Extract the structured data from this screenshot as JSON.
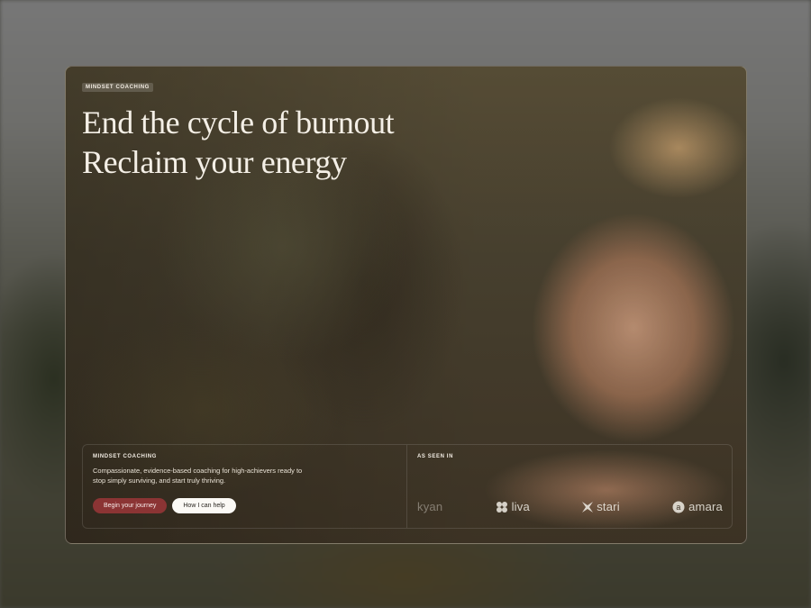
{
  "hero": {
    "eyebrow": "MINDSET COACHING",
    "headline_line1": "End the cycle of burnout",
    "headline_line2": "Reclaim your energy"
  },
  "panel": {
    "left_label": "MINDSET COACHING",
    "description": "Compassionate, evidence-based coaching for high-achievers ready to stop simply surviving, and start truly thriving.",
    "primary_button": "Begin your journey",
    "secondary_button": "How I can help",
    "right_label": "AS SEEN IN",
    "logos": [
      {
        "name": "kyan",
        "icon": "kyan-logo-icon"
      },
      {
        "name": "liva",
        "icon": "liva-logo-icon"
      },
      {
        "name": "stari",
        "icon": "stari-logo-icon"
      },
      {
        "name": "amara",
        "icon": "amara-logo-icon"
      }
    ]
  },
  "colors": {
    "primary_button": "#8b3434",
    "secondary_button": "#fbf9f5",
    "text_light": "#f4efe6"
  }
}
